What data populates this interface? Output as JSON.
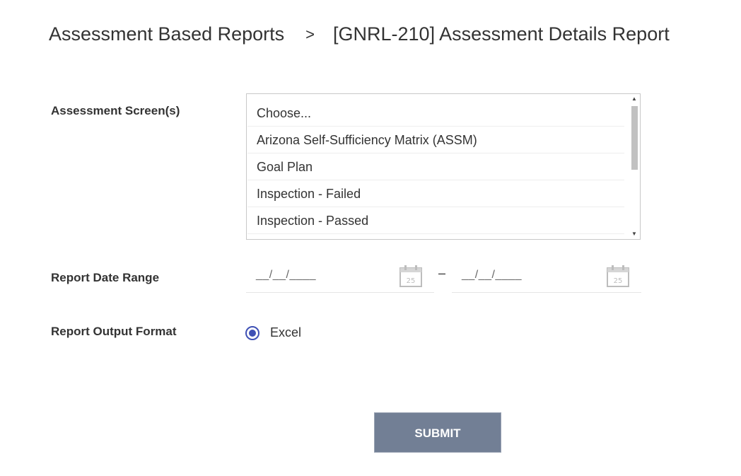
{
  "header": {
    "breadcrumb_parent": "Assessment Based Reports",
    "breadcrumb_separator": ">",
    "breadcrumb_current": "[GNRL-210] Assessment Details Report"
  },
  "form": {
    "assessment_screens": {
      "label": "Assessment Screen(s)",
      "options": [
        "Choose...",
        "Arizona Self-Sufficiency Matrix (ASSM)",
        "Goal Plan",
        "Inspection - Failed",
        "Inspection - Passed"
      ]
    },
    "date_range": {
      "label": "Report Date Range",
      "start_mask": "__/__/____",
      "end_mask": "__/__/____",
      "separator": "–",
      "calendar_day": "25"
    },
    "output_format": {
      "label": "Report Output Format",
      "selected_option": "Excel"
    },
    "submit_label": "SUBMIT"
  },
  "colors": {
    "accent_radio": "#3f51b5",
    "submit_bg": "#727f95",
    "text": "#333333"
  }
}
